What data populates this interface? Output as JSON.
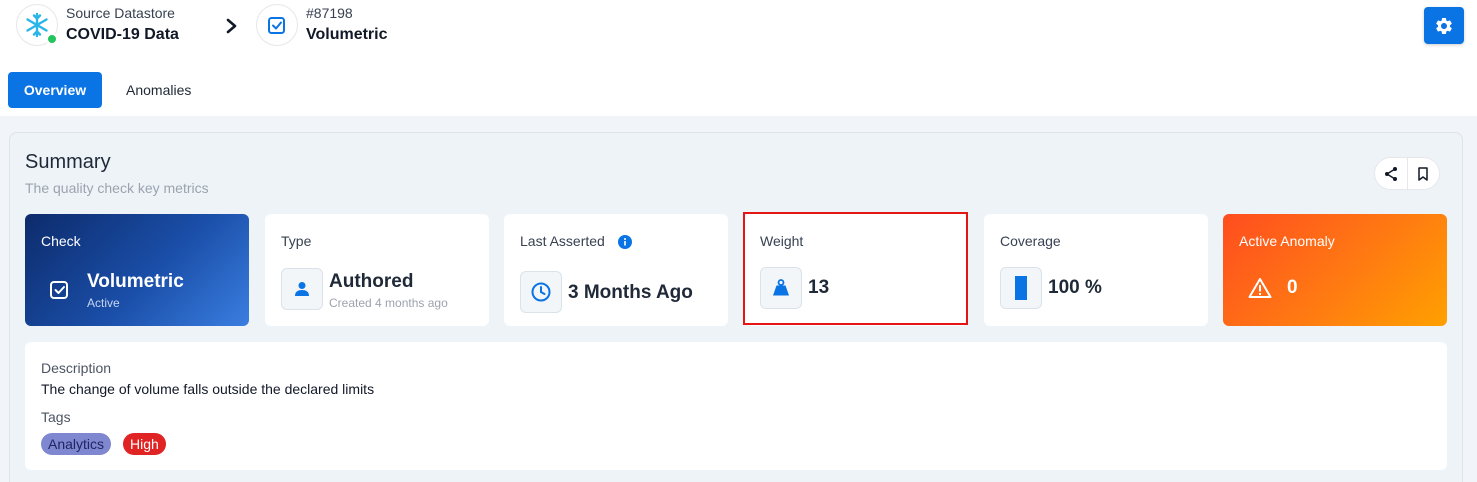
{
  "header": {
    "datastore": {
      "label": "Source Datastore",
      "name": "COVID-19 Data"
    },
    "check": {
      "id": "#87198",
      "name": "Volumetric"
    }
  },
  "tabs": [
    {
      "label": "Overview",
      "active": true
    },
    {
      "label": "Anomalies",
      "active": false
    }
  ],
  "summary": {
    "title": "Summary",
    "subtitle": "The quality check key metrics"
  },
  "cards": {
    "check": {
      "label": "Check",
      "value": "Volumetric",
      "status": "Active"
    },
    "type": {
      "label": "Type",
      "value": "Authored",
      "sub": "Created 4 months ago"
    },
    "last_asserted": {
      "label": "Last Asserted",
      "value": "3 Months Ago"
    },
    "weight": {
      "label": "Weight",
      "value": "13"
    },
    "coverage": {
      "label": "Coverage",
      "value": "100 %",
      "fraction": 1.0
    },
    "active_anomaly": {
      "label": "Active Anomaly",
      "value": "0"
    }
  },
  "description": {
    "label": "Description",
    "text": "The change of volume falls outside the declared limits"
  },
  "tags": {
    "label": "Tags",
    "items": [
      "Analytics",
      "High"
    ]
  },
  "colors": {
    "primary": "#0b74e5",
    "status_online": "#22c55e",
    "highlight": "#e51515",
    "tag_analytics": "#7e87d0",
    "tag_high": "#e02424"
  }
}
